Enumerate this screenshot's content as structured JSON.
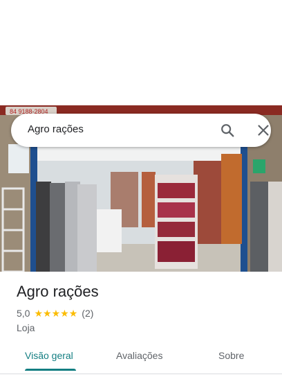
{
  "search": {
    "query": "Agro rações"
  },
  "photo": {
    "sign_phone_text": "84 9188-2804"
  },
  "place": {
    "name": "Agro rações",
    "rating": "5,0",
    "stars": 5,
    "reviews": "(2)",
    "category": "Loja"
  },
  "tabs": [
    {
      "label": "Visão geral",
      "active": true
    },
    {
      "label": "Avaliações",
      "active": false
    },
    {
      "label": "Sobre",
      "active": false
    }
  ],
  "colors": {
    "accent": "#137e82",
    "star": "#fbbc04",
    "text": "#202124",
    "secondary": "#5f6368"
  },
  "icons": {
    "search": "search-icon",
    "close": "close-icon"
  }
}
